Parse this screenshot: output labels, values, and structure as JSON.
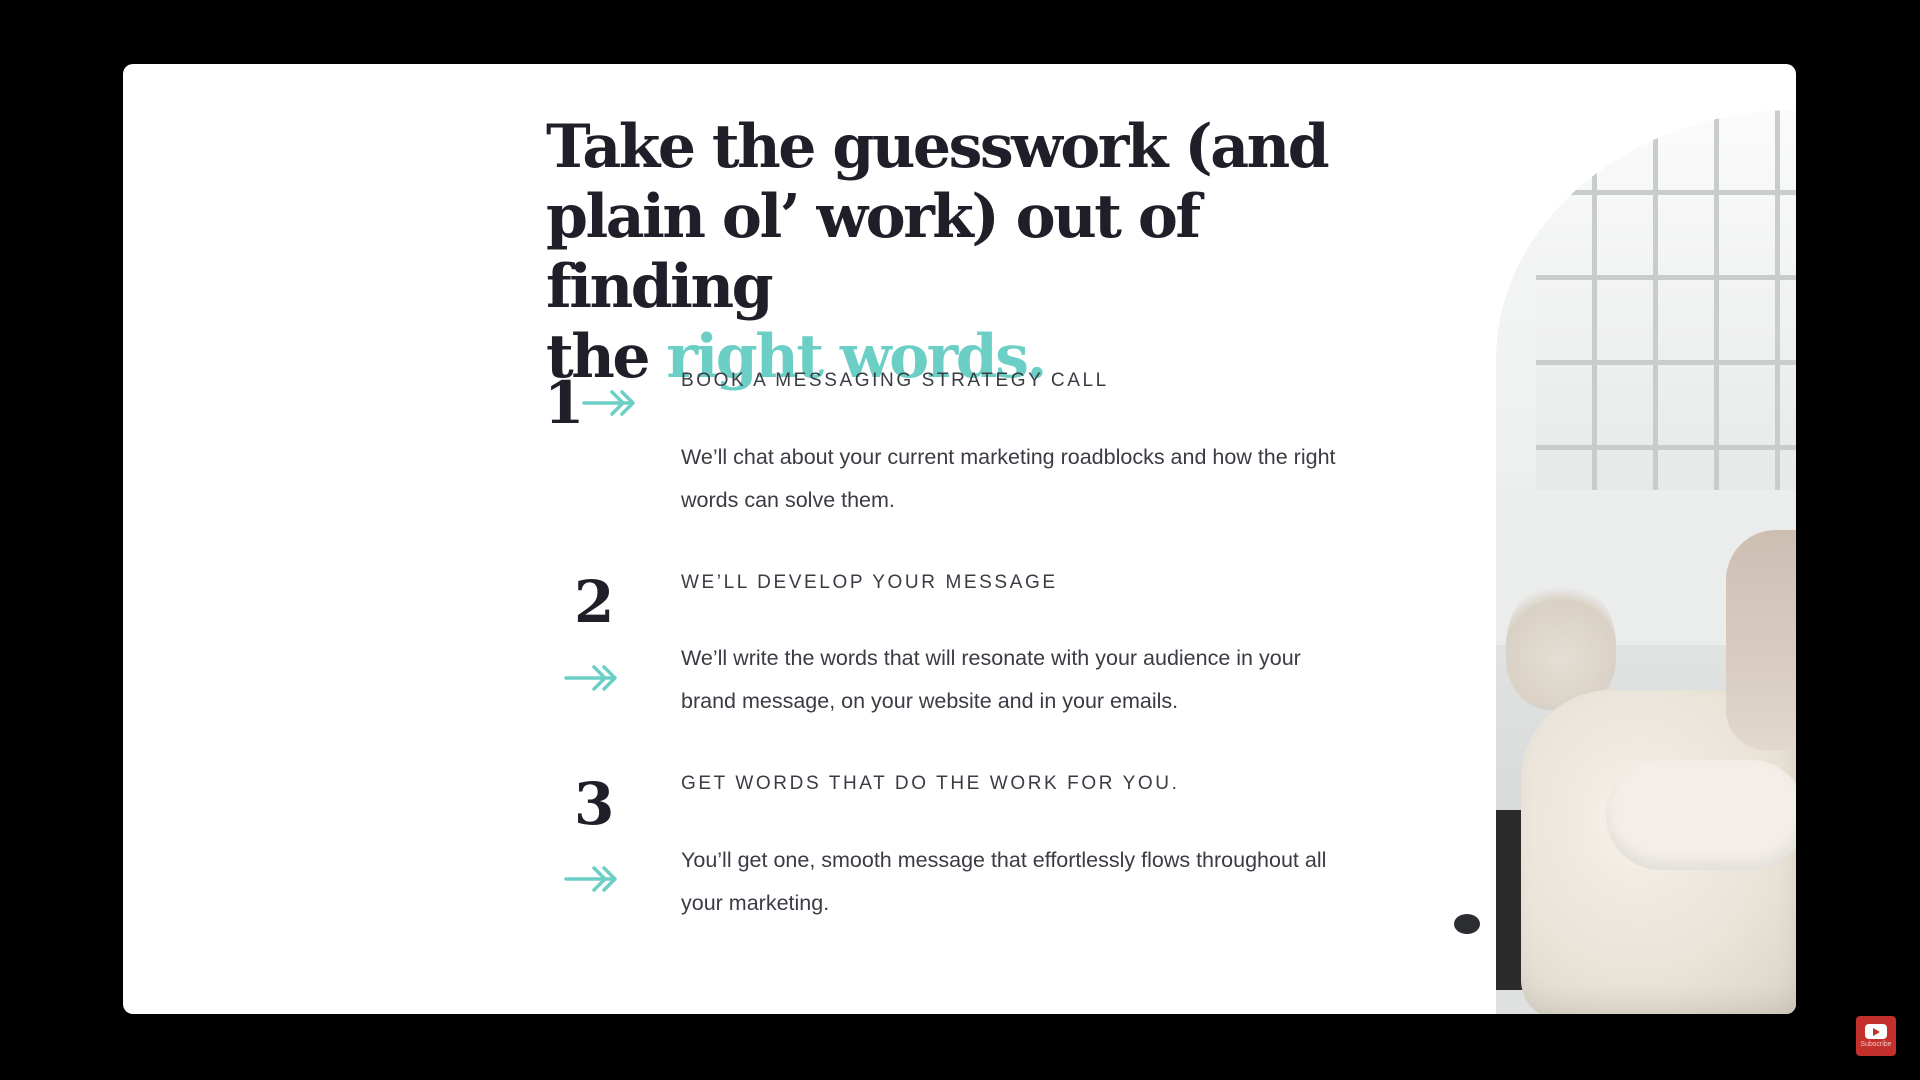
{
  "headline": {
    "line1": "Take the guesswork (and",
    "line2": "plain ol’ work) out of finding",
    "line3_prefix": "the ",
    "line3_accent": "right words."
  },
  "steps": [
    {
      "number": "1",
      "title": "BOOK A MESSAGING STRATEGY CALL",
      "body": "We’ll chat about your current marketing roadblocks and how the right words can solve them."
    },
    {
      "number": "2",
      "title": "WE’LL DEVELOP YOUR MESSAGE",
      "body": "We’ll write the words that will resonate with your audience in your brand message, on your website and in your emails."
    },
    {
      "number": "3",
      "title": "GET WORDS THAT DO THE WORK FOR YOU.",
      "body": "You’ll get one, smooth message that effortlessly flows throughout all your marketing."
    }
  ],
  "icons": {
    "arrow": "double-arrow-right-icon",
    "youtube": "youtube-subscribe-icon"
  },
  "youtube_badge": {
    "label": "Subscribe"
  },
  "colors": {
    "accent": "#6ccfc6",
    "heading": "#1e1f28",
    "body": "#3a3c44",
    "frame": "#000000",
    "youtube": "#c4302b"
  }
}
